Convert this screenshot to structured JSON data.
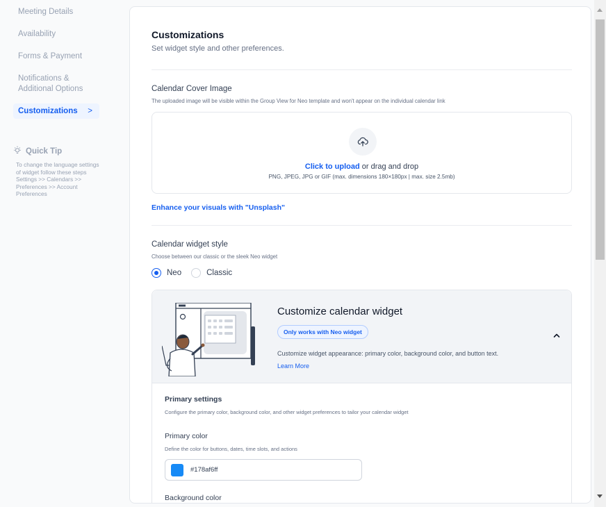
{
  "sidebar": {
    "items": [
      {
        "label": "Meeting Details"
      },
      {
        "label": "Availability"
      },
      {
        "label": "Forms & Payment"
      },
      {
        "label_line1": "Notifications &",
        "label_line2": "Additional Options"
      },
      {
        "label": "Customizations",
        "chevron": ">"
      }
    ],
    "tip": {
      "title": "Quick Tip",
      "text": "To change the language settings of widget follow these steps Settings >> Calendars >> Preferences >> Account Preferences"
    }
  },
  "main": {
    "title": "Customizations",
    "subtitle": "Set widget style and other preferences.",
    "cover": {
      "label": "Calendar Cover Image",
      "help": "The uploaded image will be visible within the Group View for Neo template and won't appear on the individual calendar link",
      "upload_link": "Click to upload",
      "upload_rest": " or drag and drop",
      "formats": "PNG, JPEG, JPG or GIF (max. dimensions 180×180px | max. size 2.5mb)",
      "icon": "upload-cloud-icon"
    },
    "unsplash_link": "Enhance your visuals with \"Unsplash\"",
    "widget_style": {
      "label": "Calendar widget style",
      "help": "Choose between our classic or the sleek Neo widget",
      "options": [
        {
          "label": "Neo",
          "selected": true
        },
        {
          "label": "Classic",
          "selected": false
        }
      ]
    },
    "customize": {
      "title": "Customize calendar widget",
      "badge": "Only works with Neo widget",
      "description": "Customize widget appearance: primary color, background color, and button text.",
      "learn_more": "Learn More",
      "primary_settings": {
        "title": "Primary settings",
        "help": "Configure the primary color, background color, and other widget preferences to tailor your calendar widget"
      },
      "primary_color": {
        "title": "Primary color",
        "help": "Define the color for buttons, dates, time slots, and actions",
        "value": "#178af6ff",
        "swatch": "#178af6"
      },
      "background_color": {
        "title": "Background color"
      }
    }
  },
  "colors": {
    "accent": "#155eef",
    "active_nav_bg": "#eef4ff"
  }
}
